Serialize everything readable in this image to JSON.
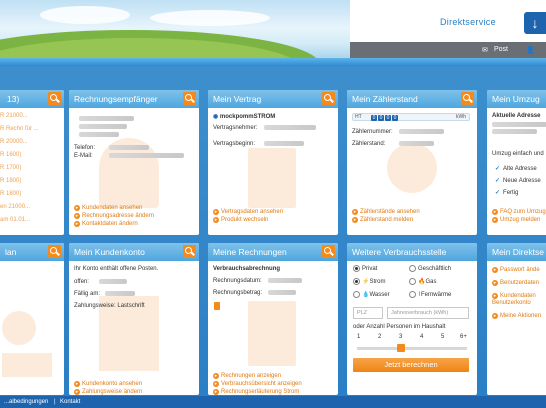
{
  "header": {
    "service_title": "Direktservice",
    "meta": {
      "post": "Post",
      "user_icon": "user-icon",
      "mail_icon": "envelope-icon"
    }
  },
  "cards": {
    "c1": {
      "title": "13)",
      "items": [
        "R 21000...",
        "R Rechn für ...",
        "R 20000...",
        "R 1600)",
        "R 1700)",
        "R 1800)",
        "R 1800)",
        "en 21000...",
        "am 01.01..."
      ]
    },
    "c2": {
      "title": "Rechnungsempfänger",
      "phone_label": "Telefon:",
      "email_label": "E-Mail:",
      "links": [
        "Kundendaten ansehen",
        "Rechnungsadresse ändern",
        "Kontaktdaten ändern"
      ]
    },
    "c3": {
      "title": "Mein Vertrag",
      "product": "mockpommSTROM",
      "holder_label": "Vertragsnehmer:",
      "start_label": "Vertragsbeginn:",
      "links": [
        "Vertragsdaten ansehen",
        "Produkt wechseln"
      ]
    },
    "c4": {
      "title": "Mein Zählerstand",
      "meter_prefix": "HT",
      "meter_digits": [
        "0",
        "0",
        "0",
        "0"
      ],
      "meter_unit": "kWh",
      "number_label": "Zählernummer:",
      "reading_label": "Zählerstand:",
      "links": [
        "Zählerstände ansehen",
        "Zählerstand melden"
      ]
    },
    "c5": {
      "title": "Mein Umzug",
      "address_label": "Aktuelle Adresse",
      "easy_text": "Umzug einfach und",
      "checks": [
        "Alte Adresse",
        "Neue Adresse",
        "Fertig"
      ],
      "links": [
        "FAQ zum Umzug",
        "Umzug melden"
      ]
    },
    "c6": {
      "title": "lan"
    },
    "c7": {
      "title": "Mein Kundenkonto",
      "intro": "Ihr Konto enthält offene Posten.",
      "open_label": "offen:",
      "due_label": "Fällig am:",
      "method_label": "Zahlungsweise: Lastschrift",
      "links": [
        "Kundenkonto ansehen",
        "Zahlungsweise ändern"
      ]
    },
    "c8": {
      "title": "Meine Rechnungen",
      "subtitle": "Verbrauchsabrechnung",
      "date_label": "Rechnungsdatum:",
      "amount_label": "Rechnungsbetrag:",
      "links": [
        "Rechnungen anzeigen",
        "Verbrauchsübersicht anzeigen",
        "Rechnungserläuterung Strom"
      ]
    },
    "c9": {
      "title": "Weitere Verbrauchsstelle",
      "radio_type": [
        "Privat",
        "Geschäftlich"
      ],
      "energy": [
        "Strom",
        "Gas",
        "Wasser",
        "Fernwärme"
      ],
      "plz_placeholder": "PLZ",
      "usage_placeholder": "Jahresverbrauch (kWh)",
      "persons_label": "oder Anzahl Personen im Haushalt",
      "scale": [
        "1",
        "2",
        "3",
        "4",
        "5",
        "6+"
      ],
      "slider_value": 3,
      "button": "Jetzt berechnen"
    },
    "c10": {
      "title": "Mein Direktse",
      "links": [
        "Passwort ände",
        "Benutzerdaten",
        "Kundendaten Benutzerkonto",
        "Meine Aktionen"
      ]
    }
  },
  "footer": {
    "links": [
      "...albedingungen",
      "Kontakt"
    ]
  },
  "colors": {
    "accent": "#f28a1e",
    "header_blue": "#4ea6df",
    "brand": "#1d63ad"
  }
}
